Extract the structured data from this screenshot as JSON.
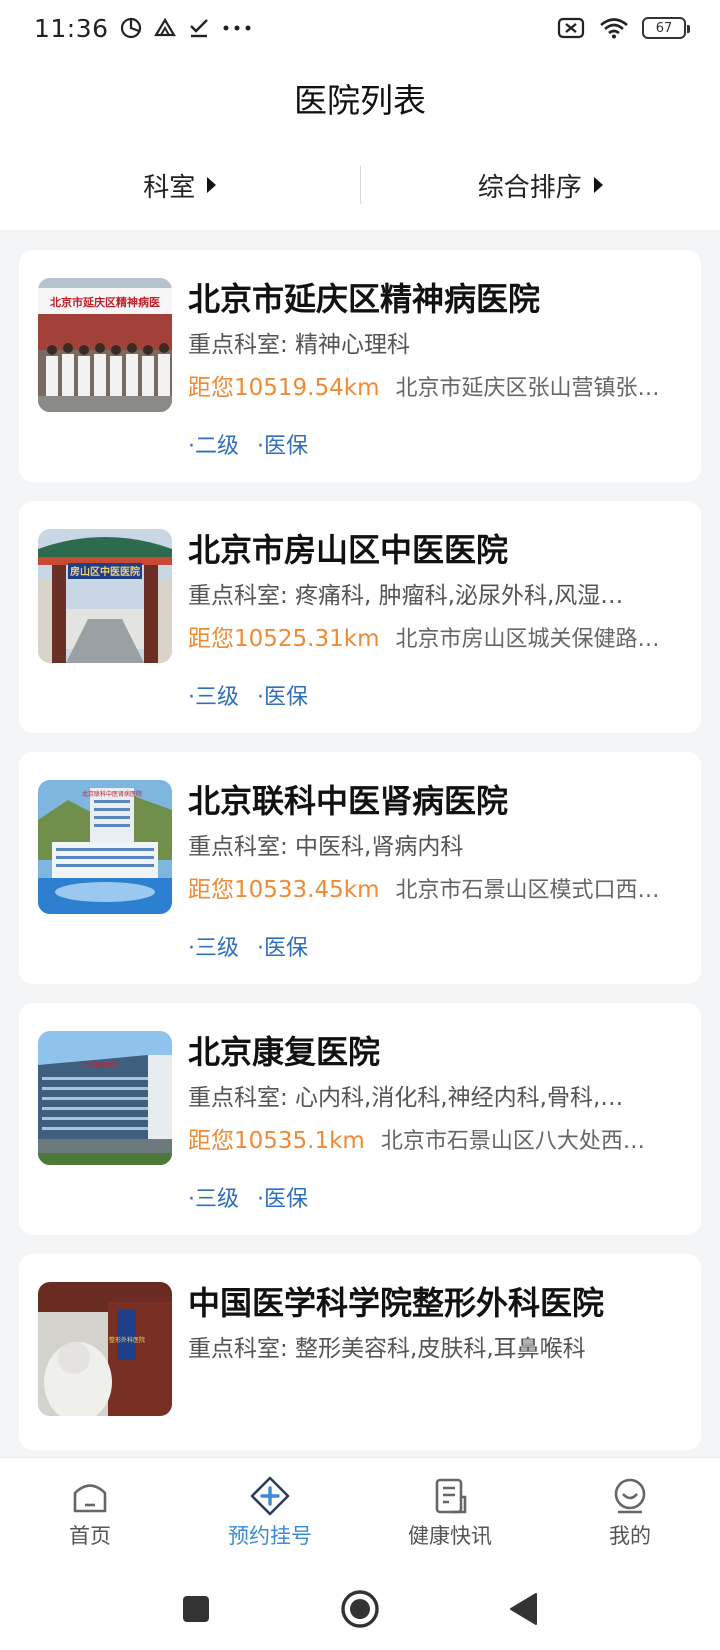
{
  "status": {
    "time": "11:36",
    "battery": "67"
  },
  "header": {
    "title": "医院列表"
  },
  "filters": [
    {
      "label": "科室"
    },
    {
      "label": "综合排序"
    }
  ],
  "hospitals": [
    {
      "name": "北京市延庆区精神病医院",
      "dept": "重点科室: 精神心理科",
      "distance": "距您10519.54km",
      "address": "北京市延庆区张山营镇张…",
      "tags": [
        "·二级",
        "·医保"
      ],
      "photo_sign": "北京市延庆区精神病医"
    },
    {
      "name": "北京市房山区中医医院",
      "dept": "重点科室: 疼痛科, 肿瘤科,泌尿外科,风湿…",
      "distance": "距您10525.31km",
      "address": "北京市房山区城关保健路…",
      "tags": [
        "·三级",
        "·医保"
      ],
      "photo_sign": "房山区中医医院"
    },
    {
      "name": "北京联科中医肾病医院",
      "dept": "重点科室: 中医科,肾病内科",
      "distance": "距您10533.45km",
      "address": "北京市石景山区模式口西…",
      "tags": [
        "·三级",
        "·医保"
      ],
      "photo_sign": "北京联科中医肾病医院"
    },
    {
      "name": "北京康复医院",
      "dept": "重点科室: 心内科,消化科,神经内科,骨科,…",
      "distance": "距您10535.1km",
      "address": "北京市石景山区八大处西…",
      "tags": [
        "·三级",
        "·医保"
      ],
      "photo_sign": "北京康复医院"
    },
    {
      "name": "中国医学科学院整形外科医院",
      "dept": "重点科室: 整形美容科,皮肤科,耳鼻喉科",
      "distance": "",
      "address": "",
      "tags": [],
      "photo_sign": "整形外科医院"
    }
  ],
  "nav": [
    {
      "label": "首页",
      "icon": "home-icon"
    },
    {
      "label": "预约挂号",
      "icon": "register-plus-icon",
      "active": true
    },
    {
      "label": "健康快讯",
      "icon": "news-icon"
    },
    {
      "label": "我的",
      "icon": "profile-icon"
    }
  ],
  "colors": {
    "accent": "#3a8bd8",
    "distance": "#f08a34",
    "tag": "#2f6fbe"
  }
}
